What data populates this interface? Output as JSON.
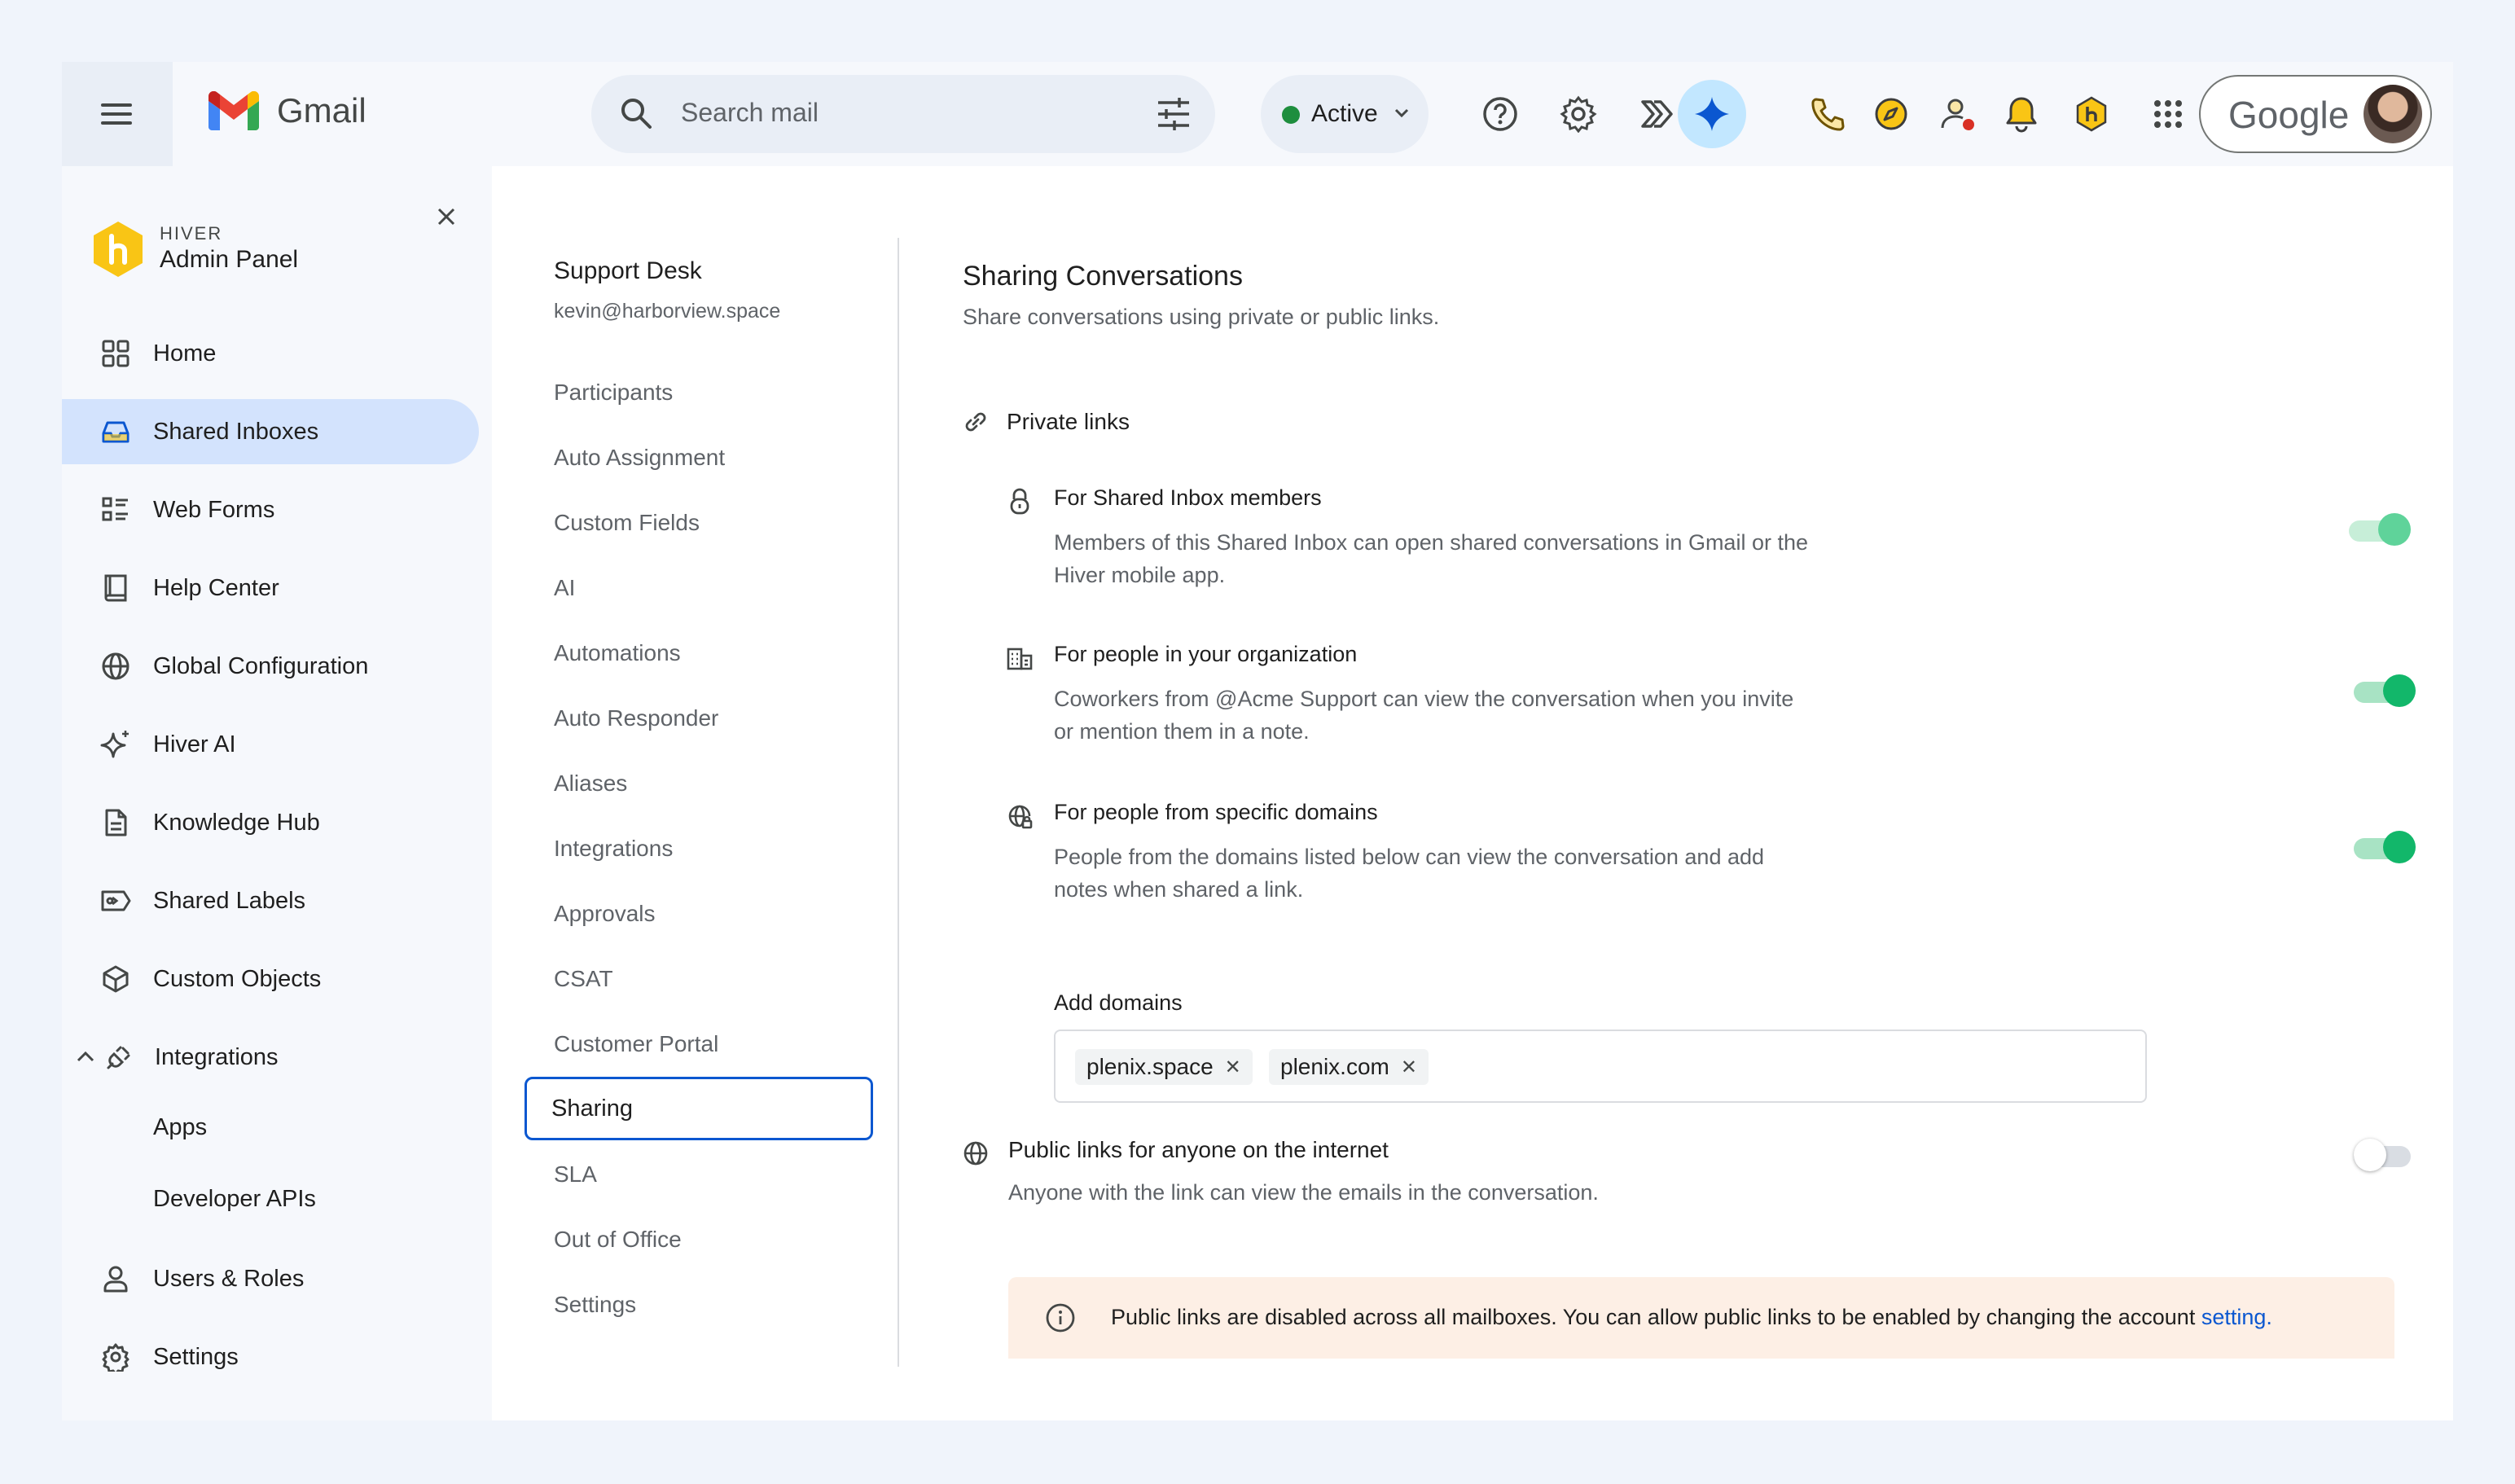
{
  "app": {
    "name": "Gmail"
  },
  "search": {
    "placeholder": "Search mail"
  },
  "status": {
    "label": "Active",
    "color": "#1e8e3e"
  },
  "google": {
    "label": "Google"
  },
  "colors": {
    "accent": "#0b57d0",
    "toggle_on": "#12b76a",
    "active_bg": "#d3e3fd",
    "banner_bg": "#fdefe5",
    "hiver_yellow": "#f9c515"
  },
  "sidebar": {
    "brand_small": "HIVER",
    "brand_title": "Admin Panel",
    "items": [
      {
        "label": "Home",
        "icon": "grid-icon"
      },
      {
        "label": "Shared Inboxes",
        "icon": "inbox-icon"
      },
      {
        "label": "Web Forms",
        "icon": "form-icon"
      },
      {
        "label": "Help Center",
        "icon": "book-icon"
      },
      {
        "label": "Global Configuration",
        "icon": "globe-icon"
      },
      {
        "label": "Hiver AI",
        "icon": "sparkle-icon"
      },
      {
        "label": "Knowledge Hub",
        "icon": "document-icon"
      },
      {
        "label": "Shared Labels",
        "icon": "label-icon"
      },
      {
        "label": "Custom Objects",
        "icon": "cube-icon"
      },
      {
        "label": "Integrations",
        "icon": "plug-icon"
      },
      {
        "label": "Apps"
      },
      {
        "label": "Developer APIs"
      },
      {
        "label": "Users & Roles",
        "icon": "user-icon"
      },
      {
        "label": "Settings",
        "icon": "gear-icon"
      }
    ]
  },
  "inbox": {
    "name": "Support Desk",
    "email": "kevin@harborview.space",
    "nav": [
      "Participants",
      "Auto Assignment",
      "Custom Fields",
      "AI",
      "Automations",
      "Auto Responder",
      "Aliases",
      "Integrations",
      "Approvals",
      "CSAT",
      "Customer Portal",
      "Sharing",
      "SLA",
      "Out of Office",
      "Settings"
    ]
  },
  "content": {
    "title": "Sharing Conversations",
    "subtitle": "Share conversations using private or public links.",
    "private": {
      "title": "Private links",
      "options": [
        {
          "title": "For Shared Inbox members",
          "desc": "Members of this Shared Inbox can open shared conversations in Gmail or the Hiver mobile app.",
          "enabled": true
        },
        {
          "title": "For people in your organization",
          "desc": "Coworkers from @Acme Support can view the conversation when you invite or mention them in a note.",
          "enabled": true
        },
        {
          "title": "For people from specific domains",
          "desc": "People from the domains listed below can view the conversation and add notes when shared a link.",
          "enabled": true
        }
      ],
      "domains_label": "Add domains",
      "domains": [
        "plenix.space",
        "plenix.com"
      ]
    },
    "public": {
      "title": "Public links for anyone on the internet",
      "desc": "Anyone with the link can view the emails in the conversation.",
      "enabled": false
    },
    "banner": {
      "text": "Public links are disabled across all mailboxes. You can allow public links to be enabled by changing the account ",
      "link": "setting."
    }
  }
}
